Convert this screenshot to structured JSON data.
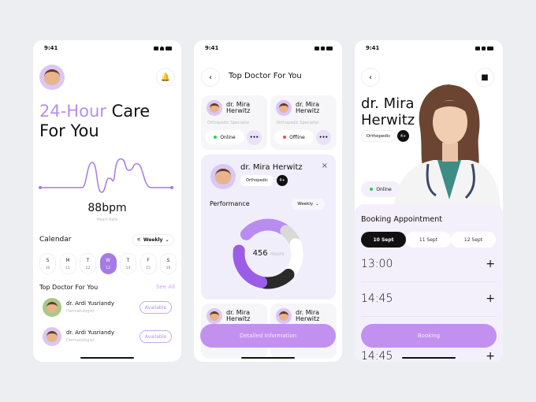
{
  "status_time": "9:41",
  "screen1": {
    "title_accent": "24-Hour",
    "title_rest": " Care",
    "title_line2": "For You",
    "heart_value": "88bpm",
    "heart_label": "Heart Rate",
    "calendar_title": "Calendar",
    "filter_label": "Weekly",
    "days": [
      {
        "d": "S",
        "n": "10"
      },
      {
        "d": "M",
        "n": "11"
      },
      {
        "d": "T",
        "n": "12"
      },
      {
        "d": "W",
        "n": "13",
        "selected": true
      },
      {
        "d": "T",
        "n": "14"
      },
      {
        "d": "F",
        "n": "15"
      },
      {
        "d": "S",
        "n": "16"
      }
    ],
    "top_doctor_title": "Top Doctor For You",
    "see_all": "See All",
    "doctors": [
      {
        "name": "dr. Ardi Yusriandy",
        "specialty": "Dermatologist",
        "status": "Available",
        "avatar_color": "#a7c98a"
      },
      {
        "name": "dr. Ardi Yusriandy",
        "specialty": "Dermatologist",
        "status": "Available",
        "avatar_color": "#d9c8f5"
      }
    ]
  },
  "screen2": {
    "title": "Top Doctor For You",
    "cards": [
      {
        "name1": "dr. Mira",
        "name2": "Herwitz",
        "specialty": "Orthopedic Specialist",
        "status": "Online",
        "status_color": "#2ecc55"
      },
      {
        "name1": "dr. Mira",
        "name2": "Herwitz",
        "specialty": "Orthopedic Specialist",
        "status": "Offline",
        "status_color": "#ef4a5a"
      }
    ],
    "detail": {
      "name": "dr. Mira Herwitz",
      "tag": "Orthopedic",
      "badge": "4+",
      "performance": "Performance",
      "filter": "Weekly",
      "total": "456",
      "unit": "Hours"
    },
    "donut_segments": [
      {
        "color": "#b98cf0",
        "share": 0.24
      },
      {
        "color": "#d9d9d9",
        "share": 0.09
      },
      {
        "color": "#ffffff",
        "share": 0.18
      },
      {
        "color": "#2a2a2a",
        "share": 0.16
      },
      {
        "color": "#9b5de5",
        "share": 0.25
      }
    ],
    "bottom_cards": [
      {
        "name1": "dr. Mira",
        "name2": "Herwitz"
      },
      {
        "name1": "dr. Mira",
        "name2": "Herwitz"
      }
    ],
    "button": "Detailed Information"
  },
  "screen3": {
    "name1": "dr. Mira",
    "name2": "Herwitz",
    "tag": "Orthopedic",
    "badge": "4+",
    "status": "Online",
    "booking_title": "Booking Appointment",
    "dates": [
      {
        "label": "10 Sept",
        "selected": true
      },
      {
        "label": "11 Sept"
      },
      {
        "label": "12 Sept"
      }
    ],
    "times": [
      "13:00",
      "14:45",
      "14:45"
    ],
    "button": "Booking"
  },
  "colors": {
    "accent": "#a77ae6",
    "button": "#c291f0",
    "panel": "#f3f0fb"
  }
}
